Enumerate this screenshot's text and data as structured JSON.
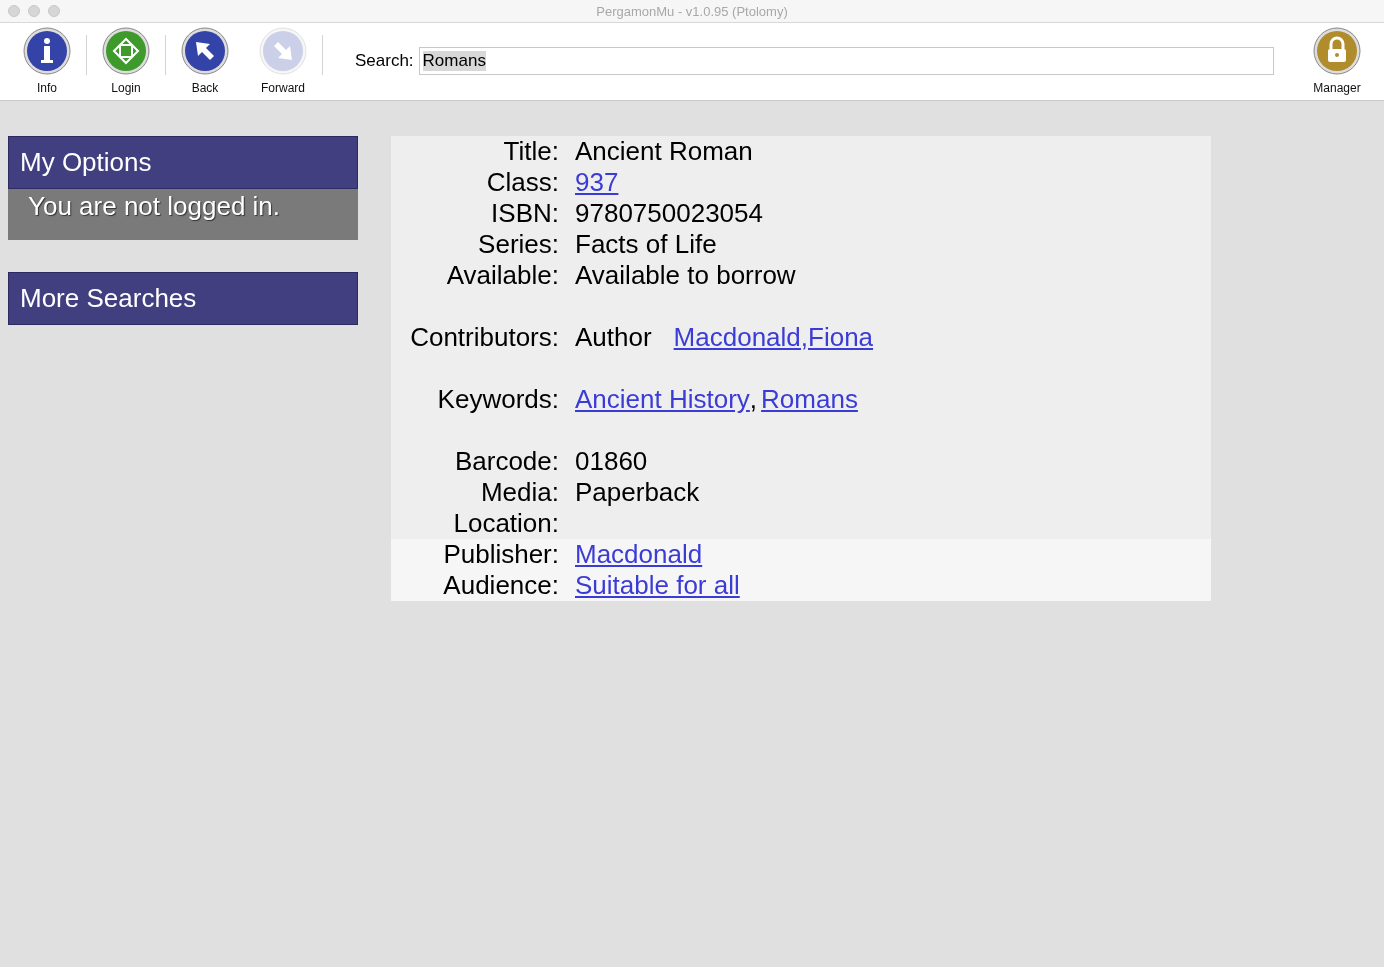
{
  "window": {
    "title": "PergamonMu - v1.0.95 (Ptolomy)"
  },
  "toolbar": {
    "buttons": [
      {
        "kind": "info",
        "label": "Info",
        "disabled": false
      },
      {
        "kind": "login",
        "label": "Login",
        "disabled": false
      },
      {
        "kind": "back",
        "label": "Back",
        "disabled": false
      },
      {
        "kind": "forward",
        "label": "Forward",
        "disabled": true
      }
    ],
    "search": {
      "label": "Search:",
      "value": "Romans"
    },
    "manager": {
      "kind": "manager",
      "label": "Manager",
      "disabled": false
    }
  },
  "sidebar": {
    "panels": [
      {
        "title": "My Options",
        "body": "You are not logged in."
      },
      {
        "title": "More Searches"
      }
    ]
  },
  "details": {
    "sections": [
      {
        "kind": "plain",
        "rows": [
          {
            "label": "Title:",
            "parts": [
              {
                "kind": "text",
                "text": "Ancient Roman"
              }
            ]
          },
          {
            "label": "Class:",
            "parts": [
              {
                "kind": "link",
                "text": "937"
              }
            ]
          },
          {
            "label": "ISBN:",
            "parts": [
              {
                "kind": "text",
                "text": "9780750023054"
              }
            ]
          },
          {
            "label": "Series:",
            "parts": [
              {
                "kind": "text",
                "text": "Facts of Life"
              }
            ]
          },
          {
            "label": "Available:",
            "parts": [
              {
                "kind": "text",
                "text": "Available to borrow"
              }
            ]
          }
        ]
      },
      {
        "kind": "plain",
        "rows": [
          {
            "label": "Contributors:",
            "parts": [
              {
                "kind": "text",
                "text": "Author"
              },
              {
                "kind": "link",
                "text": "Macdonald,Fiona"
              }
            ]
          }
        ]
      },
      {
        "kind": "plain",
        "rows": [
          {
            "label": "Keywords:",
            "parts": [
              {
                "kind": "link",
                "text": "Ancient History"
              },
              {
                "kind": "sep",
                "text": ","
              },
              {
                "kind": "link",
                "text": "Romans"
              }
            ]
          }
        ]
      },
      {
        "kind": "plain",
        "rows": [
          {
            "label": "Barcode:",
            "parts": [
              {
                "kind": "text",
                "text": "01860"
              }
            ]
          },
          {
            "label": "Media:",
            "parts": [
              {
                "kind": "text",
                "text": "Paperback"
              }
            ]
          },
          {
            "label": "Location:",
            "parts": []
          }
        ]
      },
      {
        "kind": "light",
        "rows": [
          {
            "label": "Publisher:",
            "parts": [
              {
                "kind": "link",
                "text": "Macdonald"
              }
            ]
          },
          {
            "label": "Audience:",
            "parts": [
              {
                "kind": "link",
                "text": "Suitable for all"
              }
            ]
          }
        ]
      }
    ]
  }
}
